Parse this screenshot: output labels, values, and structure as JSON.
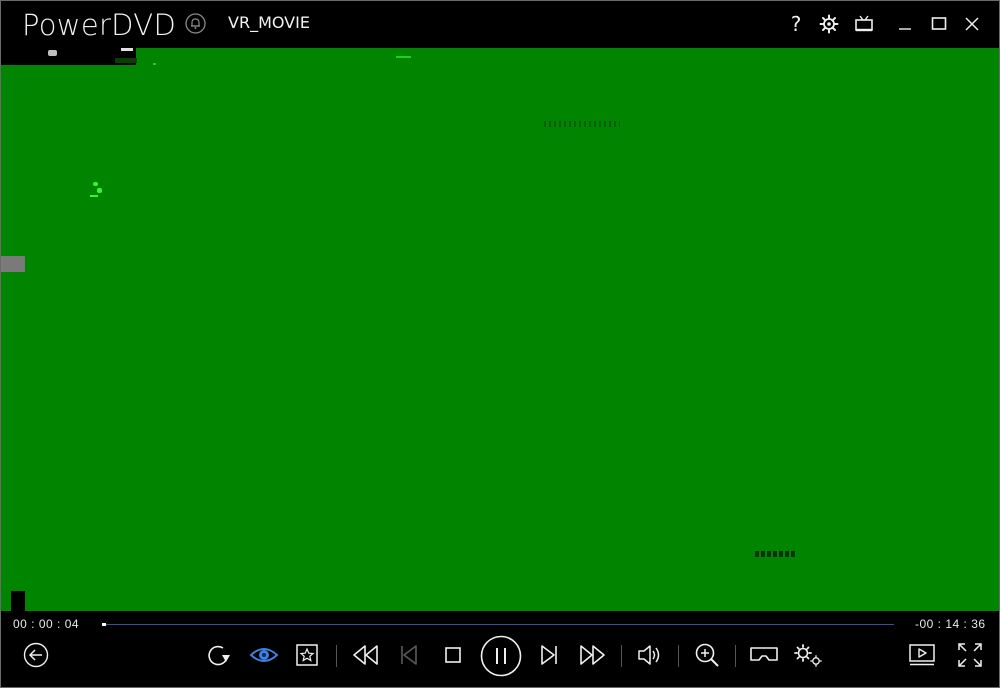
{
  "app": {
    "name": "PowerDVD",
    "title": "VR_MOVIE"
  },
  "titlebar": {
    "buttons": [
      {
        "name": "help-button",
        "icon": "help-icon",
        "glyph": "?"
      },
      {
        "name": "settings-button",
        "icon": "gear-icon"
      },
      {
        "name": "tv-mode-button",
        "icon": "tv-icon"
      },
      {
        "name": "minimize-button",
        "icon": "minimize-icon"
      },
      {
        "name": "maximize-button",
        "icon": "maximize-icon"
      },
      {
        "name": "close-button",
        "icon": "close-icon"
      }
    ]
  },
  "video": {
    "background_color": "#018400"
  },
  "playback": {
    "elapsed": "00 : 00 : 04",
    "remaining": "-00 : 14 : 36",
    "progress_fraction": 0.0045
  },
  "controls": {
    "back": "back-arrow-icon",
    "left_group": [
      "repeat-icon",
      "eye-icon",
      "bookmark-icon"
    ],
    "center_group": [
      "rewind-icon",
      "previous-chapter-icon",
      "stop-icon",
      "pause-icon",
      "next-chapter-icon",
      "fast-forward-icon"
    ],
    "right_group": [
      "volume-icon",
      "zoom-icon",
      "vr-headset-icon",
      "advanced-settings-icon"
    ],
    "far_right": [
      "cast-icon",
      "fullscreen-icon"
    ],
    "accent_color": "#3f7fe0"
  }
}
